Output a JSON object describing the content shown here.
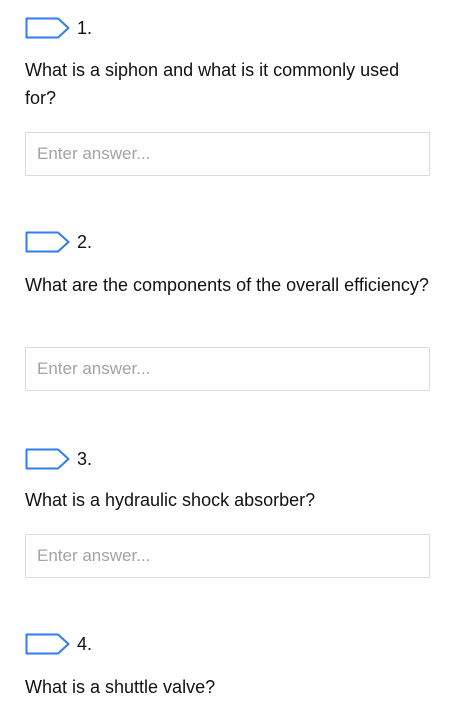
{
  "questions": [
    {
      "number": "1.",
      "text": "What is a siphon and what is it commonly used for?",
      "answer_value": "",
      "answer_placeholder": "Enter answer..."
    },
    {
      "number": "2.",
      "text": "What are the components of the overall efficiency?",
      "answer_value": "",
      "answer_placeholder": "Enter answer..."
    },
    {
      "number": "3.",
      "text": "What is a hydraulic shock absorber?",
      "answer_value": "",
      "answer_placeholder": "Enter answer..."
    },
    {
      "number": "4.",
      "text": "What is a shuttle valve?"
    }
  ],
  "colors": {
    "flag_stroke": "#2f7df6",
    "input_border": "#dcdcdc",
    "placeholder": "#a3a3a3",
    "text": "#111111"
  },
  "icons": {
    "flag": "flag-icon"
  }
}
